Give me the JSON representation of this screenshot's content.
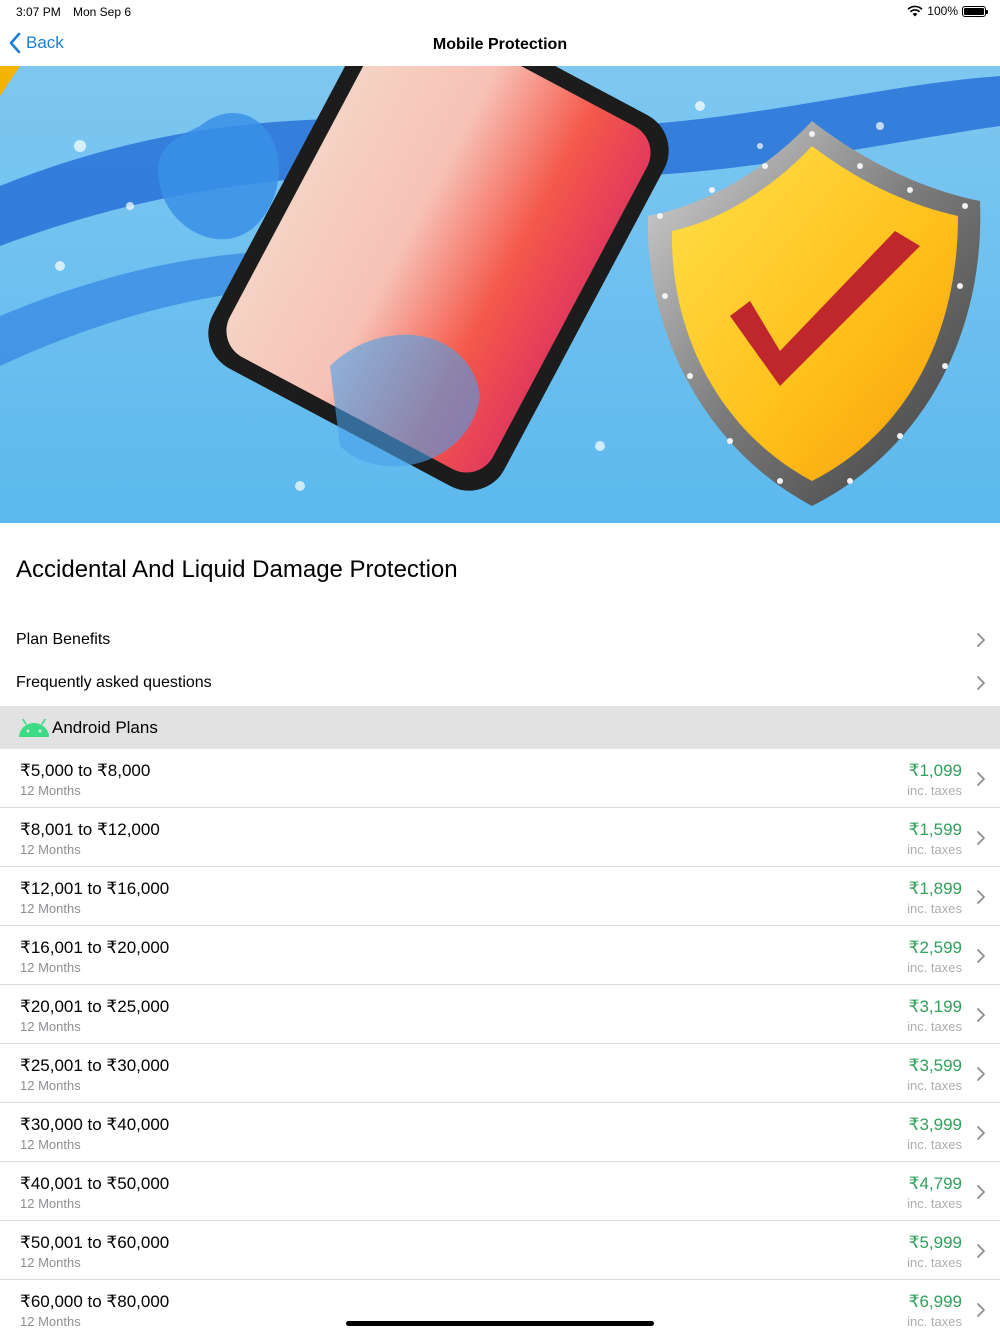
{
  "status": {
    "time": "3:07 PM",
    "date": "Mon Sep 6",
    "battery": "100%",
    "battery_level": 1.0
  },
  "nav": {
    "back_label": "Back",
    "title": "Mobile Protection"
  },
  "heading": "Accidental And Liquid Damage Protection",
  "links": [
    {
      "label": "Plan Benefits"
    },
    {
      "label": "Frequently asked questions"
    }
  ],
  "section": {
    "label": "Android Plans",
    "icon": "android-icon"
  },
  "plans": [
    {
      "range": "₹5,000 to ₹8,000",
      "term": "12 Months",
      "price": "₹1,099",
      "tax": "inc. taxes"
    },
    {
      "range": "₹8,001 to ₹12,000",
      "term": "12 Months",
      "price": "₹1,599",
      "tax": "inc. taxes"
    },
    {
      "range": "₹12,001 to ₹16,000",
      "term": "12 Months",
      "price": "₹1,899",
      "tax": "inc. taxes"
    },
    {
      "range": "₹16,001 to ₹20,000",
      "term": "12 Months",
      "price": "₹2,599",
      "tax": "inc. taxes"
    },
    {
      "range": "₹20,001 to ₹25,000",
      "term": "12 Months",
      "price": "₹3,199",
      "tax": "inc. taxes"
    },
    {
      "range": "₹25,001 to ₹30,000",
      "term": "12 Months",
      "price": "₹3,599",
      "tax": "inc. taxes"
    },
    {
      "range": "₹30,000 to ₹40,000",
      "term": "12 Months",
      "price": "₹3,999",
      "tax": "inc. taxes"
    },
    {
      "range": "₹40,001 to ₹50,000",
      "term": "12 Months",
      "price": "₹4,799",
      "tax": "inc. taxes"
    },
    {
      "range": "₹50,001 to ₹60,000",
      "term": "12 Months",
      "price": "₹5,999",
      "tax": "inc. taxes"
    },
    {
      "range": "₹60,000 to ₹80,000",
      "term": "12 Months",
      "price": "₹6,999",
      "tax": "inc. taxes"
    }
  ],
  "colors": {
    "accent": "#1a7fd6",
    "price": "#2ea15a",
    "android": "#3ddc84",
    "section_bg": "#e2e2e2"
  }
}
